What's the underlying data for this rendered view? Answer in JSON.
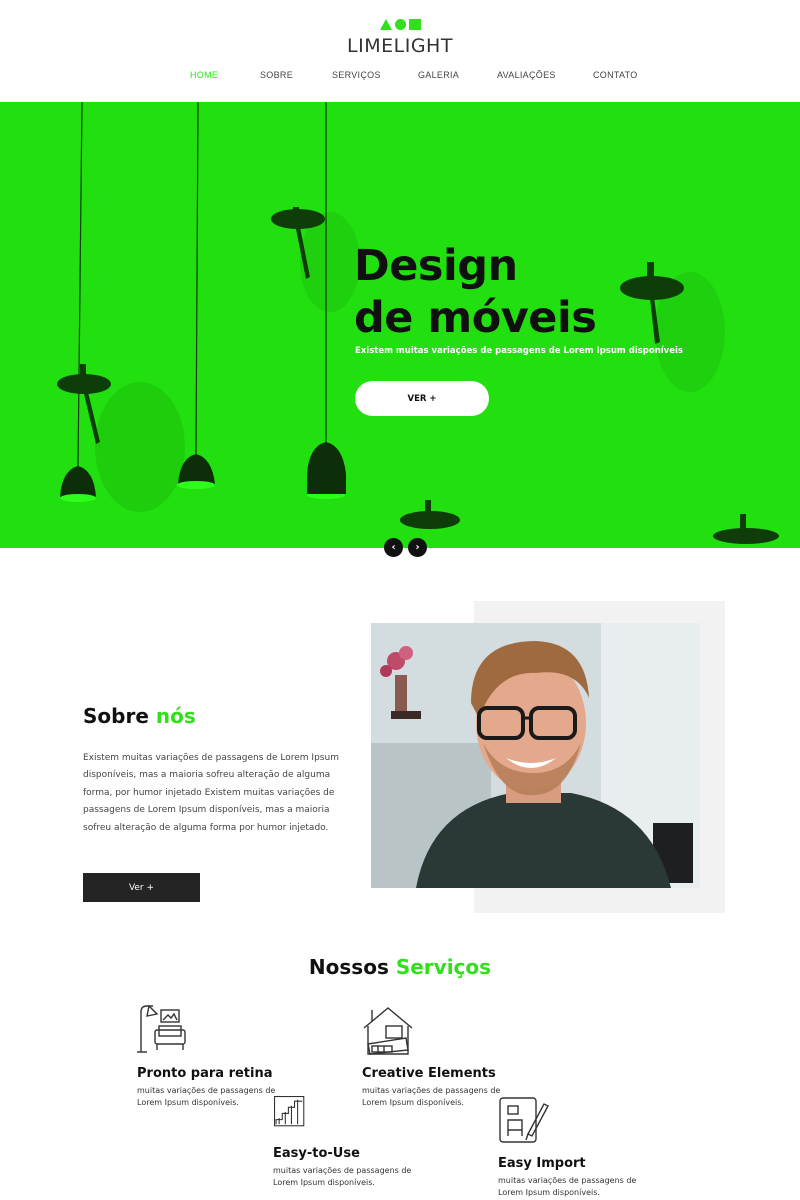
{
  "brand": {
    "name": "LIMELIGHT",
    "accent": "#2fe01b"
  },
  "nav": {
    "items": [
      {
        "label": "HOME",
        "active": true
      },
      {
        "label": "SOBRE",
        "active": false
      },
      {
        "label": "SERVIÇOS",
        "active": false
      },
      {
        "label": "GALERIA",
        "active": false
      },
      {
        "label": "AVALIAÇÕES",
        "active": false
      },
      {
        "label": "CONTATO",
        "active": false
      }
    ]
  },
  "hero": {
    "title_line1": "Design",
    "title_line2": "de móveis",
    "subtitle": "Existem muitas variações de passagens de Lorem Ipsum disponíveis",
    "button_label": "VER +",
    "prev_icon": "chevron-left-icon",
    "next_icon": "chevron-right-icon",
    "background_color": "#22e010"
  },
  "about": {
    "title_part1": "Sobre ",
    "title_part2": "nós",
    "text": "Existem muitas variações de passagens de Lorem Ipsum disponíveis, mas a maioria sofreu alteração de alguma forma, por humor injetado Existem muitas variações de passagens de Lorem Ipsum disponíveis, mas a maioria sofreu alteração de alguma forma por humor injetado.",
    "button_label": "Ver +"
  },
  "services": {
    "title_part1": "Nossos ",
    "title_part2": "Serviços",
    "items": [
      {
        "title": "Pronto para retina",
        "desc": "muitas variações de passagens de Lorem Ipsum disponíveis.",
        "icon": "armchair-lamp-icon"
      },
      {
        "title": "Creative Elements",
        "desc": "muitas variações de passagens de Lorem Ipsum disponíveis.",
        "icon": "house-furniture-icon"
      },
      {
        "title": "Easy-to-Use",
        "desc": "muitas variações de passagens de Lorem Ipsum disponíveis.",
        "icon": "stairs-icon"
      },
      {
        "title": "Easy Import",
        "desc": "muitas variações de passagens de Lorem Ipsum disponíveis.",
        "icon": "blueprint-chair-icon"
      }
    ]
  }
}
